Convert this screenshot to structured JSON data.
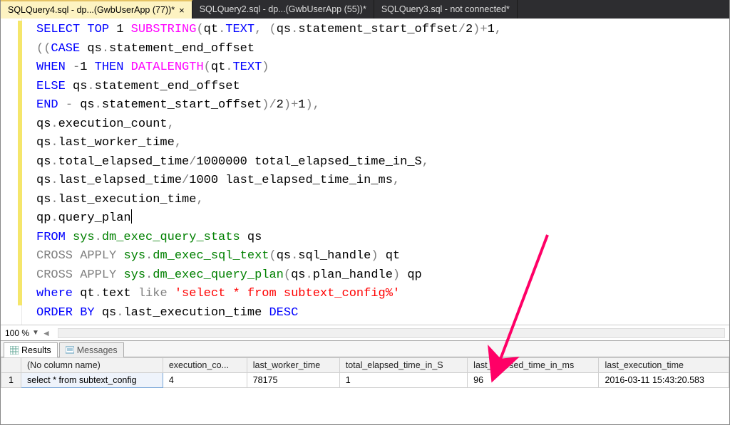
{
  "tabs": [
    {
      "label": "SQLQuery4.sql - dp...(GwbUserApp (77))*",
      "active": true
    },
    {
      "label": "SQLQuery2.sql - dp...(GwbUserApp (55))*",
      "active": false
    },
    {
      "label": "SQLQuery3.sql - not connected*",
      "active": false
    }
  ],
  "zoom": "100 %",
  "result_tabs": {
    "results": "Results",
    "messages": "Messages"
  },
  "grid": {
    "headers": [
      "(No column name)",
      "execution_co...",
      "last_worker_time",
      "total_elapsed_time_in_S",
      "last_elapsed_time_in_ms",
      "last_execution_time"
    ],
    "rownum": "1",
    "row": [
      "select * from subtext_config",
      "4",
      "78175",
      "1",
      "96",
      "2016-03-11 15:43:20.583"
    ]
  },
  "sql": {
    "l1": {
      "a": "SELECT",
      "b": "TOP",
      "c": "1",
      "d": "SUBSTRING",
      "e": "qt",
      "f": "TEXT",
      "g": "qs",
      "h": "statement_start_offset",
      "i": "2",
      "j": "1"
    },
    "l2": {
      "a": "CASE",
      "b": "qs",
      "c": "statement_end_offset"
    },
    "l3": {
      "a": "WHEN",
      "b": "-",
      "c": "1",
      "d": "THEN",
      "e": "DATALENGTH",
      "f": "qt",
      "g": "TEXT"
    },
    "l4": {
      "a": "ELSE",
      "b": "qs",
      "c": "statement_end_offset"
    },
    "l5": {
      "a": "END",
      "b": "-",
      "c": "qs",
      "d": "statement_start_offset",
      "e": "2",
      "f": "1"
    },
    "l6": {
      "a": "qs",
      "b": "execution_count"
    },
    "l7": {
      "a": "qs",
      "b": "last_worker_time"
    },
    "l8": {
      "a": "qs",
      "b": "total_elapsed_time",
      "c": "1000000",
      "d": "total_elapsed_time_in_S"
    },
    "l9": {
      "a": "qs",
      "b": "last_elapsed_time",
      "c": "1000",
      "d": "last_elapsed_time_in_ms"
    },
    "l10": {
      "a": "qs",
      "b": "last_execution_time"
    },
    "l11": {
      "a": "qp",
      "b": "query_plan"
    },
    "l12": {
      "a": "FROM",
      "b": "sys",
      "c": "dm_exec_query_stats",
      "d": "qs"
    },
    "l13": {
      "a": "CROSS",
      "b": "APPLY",
      "c": "sys",
      "d": "dm_exec_sql_text",
      "e": "qs",
      "f": "sql_handle",
      "g": "qt"
    },
    "l14": {
      "a": "CROSS",
      "b": "APPLY",
      "c": "sys",
      "d": "dm_exec_query_plan",
      "e": "qs",
      "f": "plan_handle",
      "g": "qp"
    },
    "l15": {
      "a": "where",
      "b": "qt",
      "c": "text",
      "d": "like",
      "e": "'select * from subtext_config%'"
    },
    "l16": {
      "a": "ORDER",
      "b": "BY",
      "c": "qs",
      "d": "last_execution_time",
      "e": "DESC"
    }
  }
}
